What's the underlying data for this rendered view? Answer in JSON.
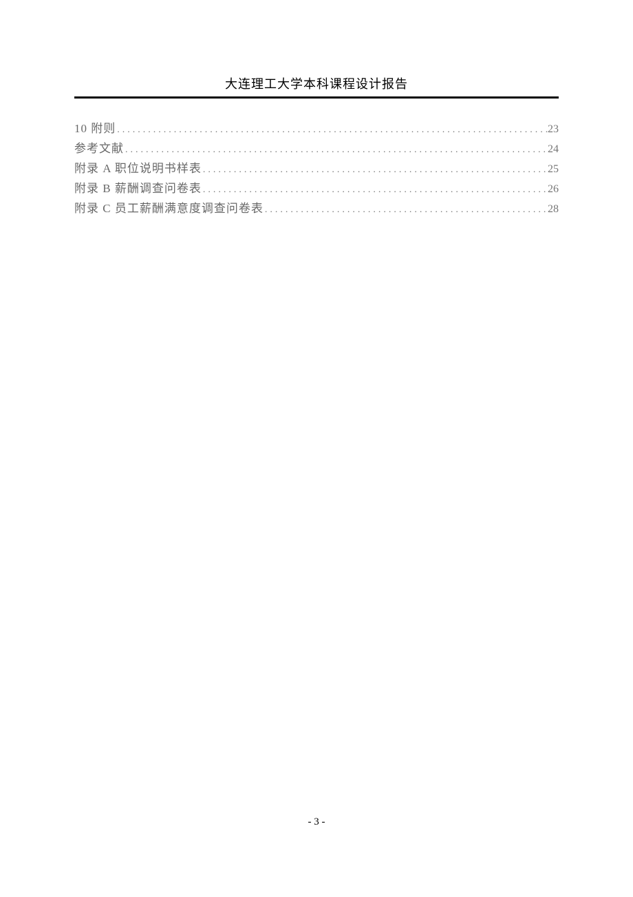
{
  "header": {
    "title": "大连理工大学本科课程设计报告"
  },
  "toc": {
    "entries": [
      {
        "title": "10  附则",
        "page": "23"
      },
      {
        "title": "参考文献",
        "page": "24"
      },
      {
        "title": "附录 A 职位说明书样表",
        "page": "25"
      },
      {
        "title": "附录 B 薪酬调查问卷表",
        "page": "26"
      },
      {
        "title": "附录 C 员工薪酬满意度调查问卷表",
        "page": "28"
      }
    ]
  },
  "footer": {
    "page_number": "- 3 -"
  },
  "dots": "........................................................................................................"
}
